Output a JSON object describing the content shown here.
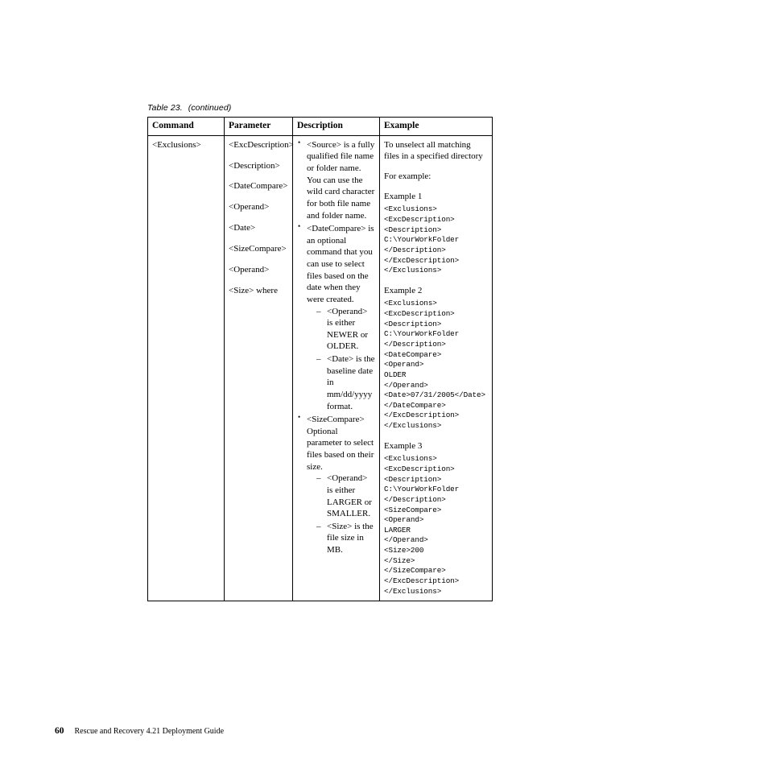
{
  "caption": {
    "number": "Table 23.",
    "continued": "(continued)"
  },
  "table": {
    "headers": {
      "command": "Command",
      "parameter": "Parameter",
      "description": "Description",
      "example": "Example"
    },
    "row": {
      "command": "<Exclusions>",
      "parameters": [
        "<ExcDescription>",
        "<Description>",
        "<DateCompare>",
        "<Operand>",
        "<Date>",
        "<SizeCompare>",
        "<Operand>",
        "<Size> where"
      ],
      "description": {
        "bullet1": "<Source> is a fully qualified file name or folder name. You can use the wild card character for both file name and folder name.",
        "bullet2": "<DateCompare> is an optional command that you can use to select files based on the date when they were created.",
        "bullet2_sub1": "<Operand> is either NEWER or OLDER.",
        "bullet2_sub2": "<Date> is the baseline date in mm/dd/yyyy format.",
        "bullet3": "<SizeCompare> Optional parameter to select files based on their size.",
        "bullet3_sub1": "<Operand> is either LARGER or SMALLER.",
        "bullet3_sub2": "<Size> is the file size in MB."
      },
      "example": {
        "intro": "To unselect all matching files in a specified directory",
        "for_example": "For example:",
        "example1_label": "Example 1",
        "example1_code": "<Exclusions>\n<ExcDescription>\n<Description>\nC:\\YourWorkFolder\n</Description>\n</ExcDescription>\n</Exclusions>",
        "example2_label": "Example 2",
        "example2_code": "<Exclusions>\n<ExcDescription>\n<Description>\nC:\\YourWorkFolder\n</Description>\n<DateCompare>\n<Operand>\nOLDER\n</Operand>\n<Date>07/31/2005</Date>\n</DateCompare>\n</ExcDescription>\n</Exclusions>",
        "example3_label": "Example 3",
        "example3_code": "<Exclusions>\n<ExcDescription>\n<Description>\nC:\\YourWorkFolder\n</Description>\n<SizeCompare>\n<Operand>\nLARGER\n</Operand>\n<Size>200\n</Size>\n</SizeCompare>\n</ExcDescription>\n</Exclusions>"
      }
    }
  },
  "footer": {
    "page_number": "60",
    "title": "Rescue and Recovery 4.21 Deployment Guide"
  }
}
